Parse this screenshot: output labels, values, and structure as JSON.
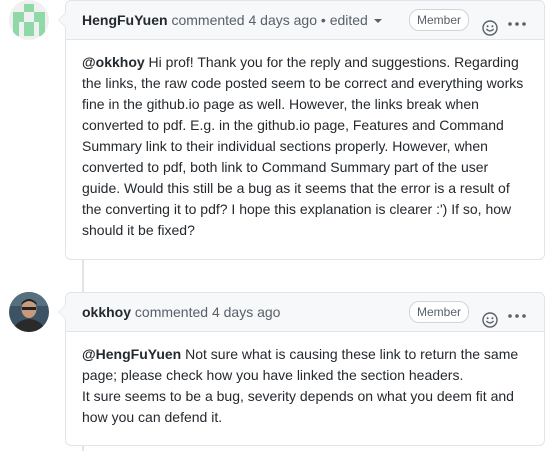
{
  "comments": [
    {
      "author": "HengFuYuen",
      "action": "commented",
      "time": "4 days ago",
      "separator": "•",
      "edited_label": "edited",
      "badge": "Member",
      "mention": "@okkhoy",
      "body": " Hi prof! Thank you for the reply and suggestions. Regarding the links, the raw code posted seem to be correct and everything works fine in the github.io page as well. However, the links break when converted to pdf. E.g. in the github.io page, Features and Command Summary link to their individual sections properly. However, when converted to pdf, both link to Command Summary part of the user guide. Would this still be a bug as it seems that the error is a result of the converting it to pdf? I hope this explanation is clearer :') If so, how should it be fixed?"
    },
    {
      "author": "okkhoy",
      "action": "commented",
      "time": "4 days ago",
      "badge": "Member",
      "mention": "@HengFuYuen",
      "body_line1": " Not sure what is causing these link to return the same page; please check how you have linked the section headers.",
      "body_line2": "It sure seems to be a bug, severity depends on what you deem fit and how you can defend it."
    }
  ],
  "icons": {
    "emoji": "smiley-icon",
    "more": "kebab-horizontal-icon",
    "caret": "triangle-down-icon"
  },
  "colors": {
    "identicon": "#8fd9a8",
    "header_bg": "#f6f8fa",
    "border": "#e1e4e8",
    "muted_text": "#586069"
  }
}
